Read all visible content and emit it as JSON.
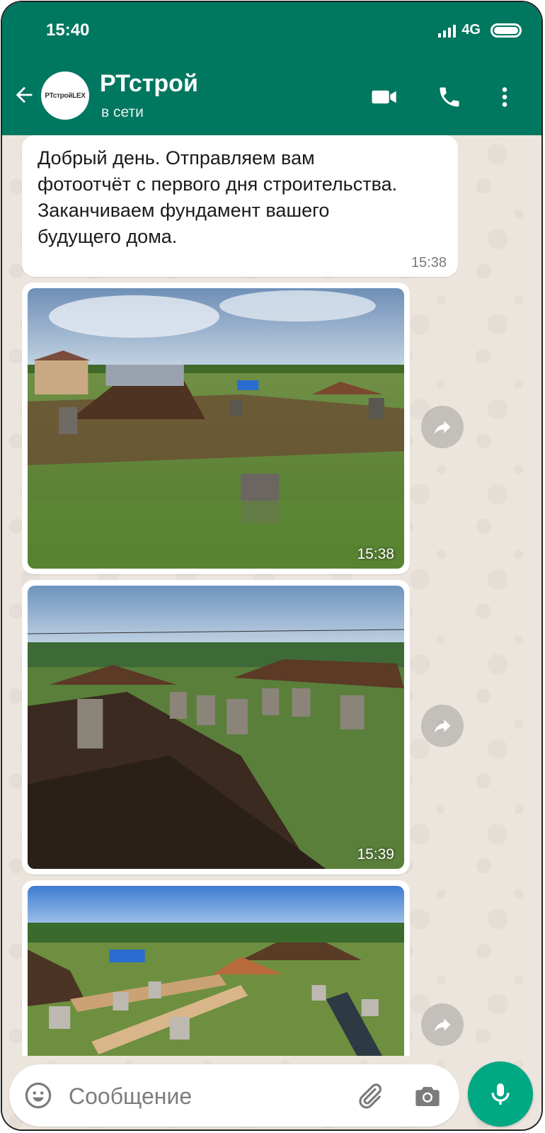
{
  "status_bar": {
    "time": "15:40",
    "network": "4G"
  },
  "header": {
    "avatar_text": "РТстройLEX",
    "contact_name": "РТстрой",
    "contact_status": "в сети"
  },
  "messages": [
    {
      "type": "text",
      "text": "Добрый день. Отправляем вам фотоотчёт с первого дня строительства. Заканчиваем фундамент вашего будущего дома.",
      "time": "15:38"
    },
    {
      "type": "photo",
      "time": "15:38"
    },
    {
      "type": "photo",
      "time": "15:39"
    },
    {
      "type": "photo",
      "time": ""
    }
  ],
  "composer": {
    "placeholder": "Сообщение"
  },
  "icons": {
    "back": "back-arrow-icon",
    "video": "video-call-icon",
    "call": "phone-call-icon",
    "menu": "more-vert-icon",
    "share": "forward-icon",
    "emoji": "emoji-icon",
    "attach": "paperclip-icon",
    "camera": "camera-icon",
    "mic": "microphone-icon"
  },
  "colors": {
    "header": "#00775f",
    "mic_button": "#00a884",
    "bubble": "#ffffff",
    "wallpaper": "#ece5dd"
  }
}
